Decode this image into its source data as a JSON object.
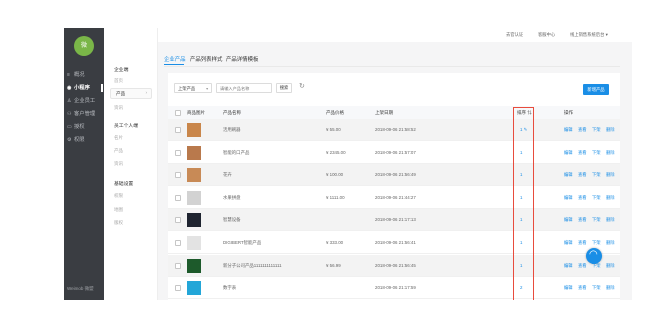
{
  "app": {
    "logo_text": "微",
    "brand": "Weimob 微盟"
  },
  "mainnav": [
    {
      "icon": "≡",
      "label": "概况"
    },
    {
      "icon": "◉",
      "label": "小程序"
    },
    {
      "icon": "♙",
      "label": "企业员工"
    },
    {
      "icon": "⚇",
      "label": "客户管理"
    },
    {
      "icon": "▭",
      "label": "授权"
    },
    {
      "icon": "⚙",
      "label": "权限"
    }
  ],
  "subnav": {
    "group1": "企业端",
    "group1_items": [
      "首页",
      "产品",
      "资讯"
    ],
    "group2": "员工个人端",
    "group2_items": [
      "名片",
      "产品",
      "资讯"
    ],
    "group3": "基础设置",
    "group3_items": [
      "权限",
      "地图",
      "版权"
    ]
  },
  "topbar": {
    "links": [
      "去官认证",
      "客服中心",
      "线上销售系统后台 ▾"
    ]
  },
  "tabs": [
    "企业产品",
    "产品列表样式",
    "产品详情模板"
  ],
  "toolbar": {
    "status_select": "上架产品",
    "search_placeholder": "请输入产品名称",
    "search_label": "搜索",
    "add_label": "新增产品"
  },
  "table": {
    "columns": [
      "商品图片",
      "产品名称",
      "产品价格",
      "上架日期",
      "排序 ⇅",
      "操作"
    ],
    "actions": [
      "编辑",
      "查看",
      "下架",
      "删除"
    ],
    "rows": [
      {
        "name": "活用刷器",
        "price": "¥ 55.00",
        "date": "2018-09-06 21:58:52",
        "sort": "1 ✎",
        "thumb_color": "#c9864a"
      },
      {
        "name": "智能的口产品",
        "price": "¥ 2345.00",
        "date": "2018-09-06 21:57:07",
        "sort": "1",
        "thumb_color": "#b9794c"
      },
      {
        "name": "花卉",
        "price": "¥ 100.00",
        "date": "2018-09-06 21:56:49",
        "sort": "1",
        "thumb_color": "#c88a56"
      },
      {
        "name": "水果拼盘",
        "price": "¥ 1111.00",
        "date": "2018-09-06 21:44:27",
        "sort": "1",
        "thumb_color": "#d2d2d2"
      },
      {
        "name": "智慧设备",
        "price": "",
        "date": "2018-09-06 21:17:13",
        "sort": "1",
        "thumb_color": "#1f2430"
      },
      {
        "name": "DIGIBERT智能产品",
        "price": "¥ 333.00",
        "date": "2018-09-06 21:56:41",
        "sort": "1",
        "thumb_color": "#e3e3e3"
      },
      {
        "name": "新分子公司产品1111111111111",
        "price": "¥ 56.99",
        "date": "2018-09-06 21:56:45",
        "sort": "1",
        "thumb_color": "#1d5a2b"
      },
      {
        "name": "数字表",
        "price": "",
        "date": "2018-09-06 21:17:59",
        "sort": "2",
        "thumb_color": "#23a6d8"
      }
    ]
  },
  "colors": {
    "accent": "#1a8ee6",
    "highlight": "#e84c3d",
    "sidebar": "#3a3d42"
  }
}
